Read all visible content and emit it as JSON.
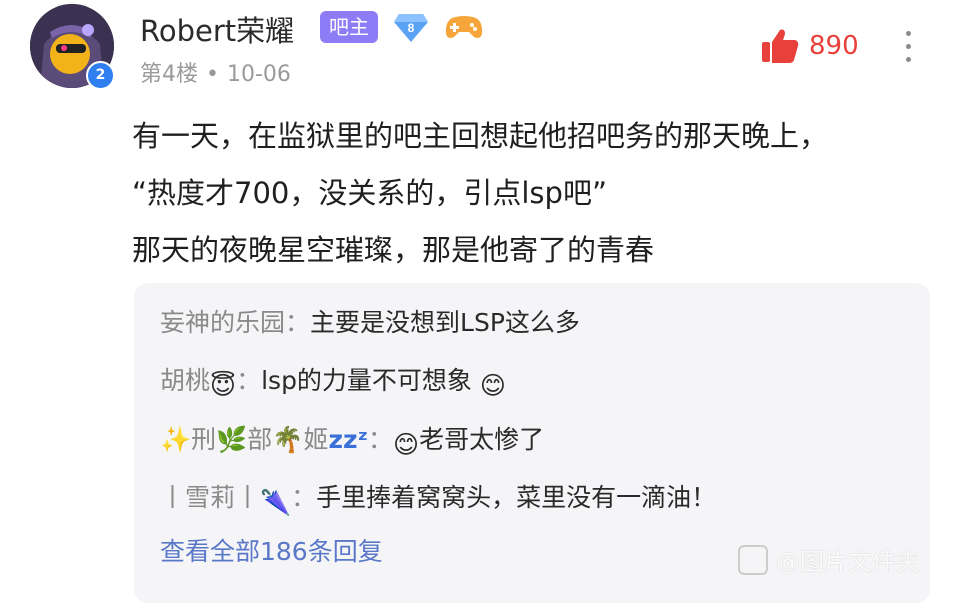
{
  "post": {
    "username": "Robert荣耀",
    "host_tag": "吧主",
    "level": "8",
    "avatar_badge": "2",
    "floor": "第4楼",
    "date": "10-06",
    "likes": "890",
    "content_lines": [
      "有一天，在监狱里的吧主回想起他招吧务的那天晚上，",
      "“热度才700，没关系的，引点lsp吧”",
      "那天的夜晚星空璀璨，那是他寄了的青春"
    ]
  },
  "replies": [
    {
      "name": "妄神的乐园：",
      "text": "主要是没想到LSP这么多"
    },
    {
      "name": "胡桃",
      "emoji_after_name": "😇",
      "sep": "：",
      "text": "lsp的力量不可想象 ",
      "emoji_after_text": "😊"
    },
    {
      "name_parts": [
        "✨",
        "刑",
        "🌿",
        "部",
        "🌴",
        "姬",
        "zzᶻ"
      ],
      "sep": "：",
      "emoji_before_text": "😊",
      "text": "老哥太惨了"
    },
    {
      "name": "丨雪莉丨",
      "emoji_after_name": "🌂",
      "sep": "：",
      "text": "手里捧着窝窝头，菜里没有一滴油！"
    }
  ],
  "view_all": "查看全部186条回复",
  "watermark": "@图片文件夹",
  "colors": {
    "host_tag": "#8e7cf6",
    "like": "#e8403a",
    "link": "#5a78c8",
    "reply_bg": "#f5f5f8",
    "level_badge": "#2f7ff0"
  },
  "icons": [
    "avatar",
    "diamond-level-icon",
    "gamepad-icon",
    "thumbs-up-icon",
    "more-vertical-icon"
  ]
}
